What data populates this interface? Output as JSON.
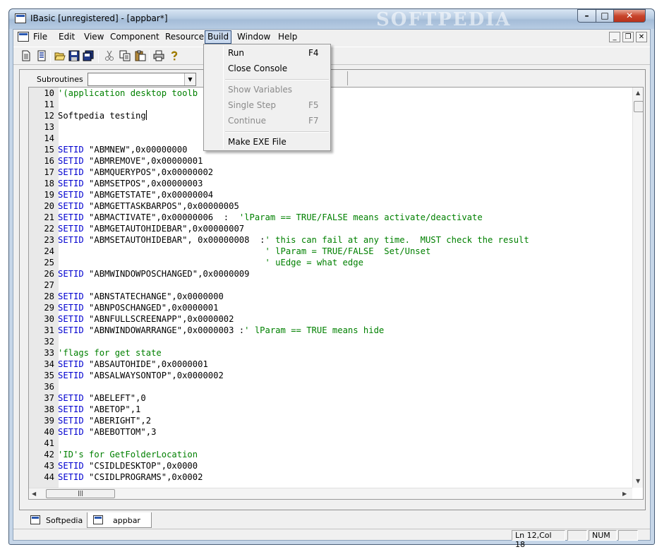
{
  "window": {
    "title": "IBasic [unregistered] - [appbar*]",
    "watermark": "SOFTPEDIA",
    "minimize": "–",
    "maximize": "□",
    "close": "✕"
  },
  "menubar": {
    "items": [
      {
        "label": "File"
      },
      {
        "label": "Edit"
      },
      {
        "label": "View"
      },
      {
        "label": "Component"
      },
      {
        "label": "Resource"
      },
      {
        "label": "Build"
      },
      {
        "label": "Window"
      },
      {
        "label": "Help"
      }
    ],
    "mdi_min": "_",
    "mdi_restore": "❐",
    "mdi_close": "✕"
  },
  "toolbar": {
    "icons": [
      "new-icon",
      "properties-icon",
      "open-icon",
      "save-icon",
      "save-all-icon",
      "cut-icon",
      "copy-icon",
      "paste-icon",
      "print-icon",
      "help-icon"
    ]
  },
  "subroutines": {
    "label": "Subroutines",
    "selected": ""
  },
  "build_menu": {
    "items": [
      {
        "label": "Run",
        "shortcut": "F4",
        "enabled": true
      },
      {
        "label": "Close Console",
        "shortcut": "",
        "enabled": true
      },
      {
        "label": "Show Variables",
        "shortcut": "",
        "enabled": false
      },
      {
        "label": "Single Step",
        "shortcut": "F5",
        "enabled": false
      },
      {
        "label": "Continue",
        "shortcut": "F7",
        "enabled": false
      },
      {
        "label": "Make EXE File",
        "shortcut": "",
        "enabled": true
      }
    ]
  },
  "editor": {
    "lines": [
      {
        "n": "10",
        "parts": [
          [
            "cm",
            "'(application desktop toolb"
          ]
        ]
      },
      {
        "n": "11",
        "parts": []
      },
      {
        "n": "12",
        "parts": [
          [
            "tx",
            "Softpedia testing"
          ]
        ],
        "caret": true
      },
      {
        "n": "13",
        "parts": []
      },
      {
        "n": "14",
        "parts": []
      },
      {
        "n": "15",
        "parts": [
          [
            "kw",
            "SETID"
          ],
          [
            "tx",
            " \"ABMNEW\",0x00000000"
          ]
        ]
      },
      {
        "n": "16",
        "parts": [
          [
            "kw",
            "SETID"
          ],
          [
            "tx",
            " \"ABMREMOVE\",0x00000001"
          ]
        ]
      },
      {
        "n": "17",
        "parts": [
          [
            "kw",
            "SETID"
          ],
          [
            "tx",
            " \"ABMQUERYPOS\",0x00000002"
          ]
        ]
      },
      {
        "n": "18",
        "parts": [
          [
            "kw",
            "SETID"
          ],
          [
            "tx",
            " \"ABMSETPOS\",0x00000003"
          ]
        ]
      },
      {
        "n": "19",
        "parts": [
          [
            "kw",
            "SETID"
          ],
          [
            "tx",
            " \"ABMGETSTATE\",0x00000004"
          ]
        ]
      },
      {
        "n": "20",
        "parts": [
          [
            "kw",
            "SETID"
          ],
          [
            "tx",
            " \"ABMGETTASKBARPOS\",0x00000005"
          ]
        ]
      },
      {
        "n": "21",
        "parts": [
          [
            "kw",
            "SETID"
          ],
          [
            "tx",
            " \"ABMACTIVATE\",0x00000006  :  "
          ],
          [
            "cm",
            "'lParam == TRUE/FALSE means activate/deactivate"
          ]
        ]
      },
      {
        "n": "22",
        "parts": [
          [
            "kw",
            "SETID"
          ],
          [
            "tx",
            " \"ABMGETAUTOHIDEBAR\",0x00000007"
          ]
        ]
      },
      {
        "n": "23",
        "parts": [
          [
            "kw",
            "SETID"
          ],
          [
            "tx",
            " \"ABMSETAUTOHIDEBAR\", 0x00000008  :"
          ],
          [
            "cm",
            "' this can fail at any time.  MUST check the result"
          ]
        ]
      },
      {
        "n": "24",
        "parts": [
          [
            "cm",
            "                                        ' lParam = TRUE/FALSE  Set/Unset"
          ]
        ]
      },
      {
        "n": "25",
        "parts": [
          [
            "cm",
            "                                        ' uEdge = what edge"
          ]
        ]
      },
      {
        "n": "26",
        "parts": [
          [
            "kw",
            "SETID"
          ],
          [
            "tx",
            " \"ABMWINDOWPOSCHANGED\",0x0000009"
          ]
        ]
      },
      {
        "n": "27",
        "parts": []
      },
      {
        "n": "28",
        "parts": [
          [
            "kw",
            "SETID"
          ],
          [
            "tx",
            " \"ABNSTATECHANGE\",0x0000000"
          ]
        ]
      },
      {
        "n": "29",
        "parts": [
          [
            "kw",
            "SETID"
          ],
          [
            "tx",
            " \"ABNPOSCHANGED\",0x0000001"
          ]
        ]
      },
      {
        "n": "30",
        "parts": [
          [
            "kw",
            "SETID"
          ],
          [
            "tx",
            " \"ABNFULLSCREENAPP\",0x0000002"
          ]
        ]
      },
      {
        "n": "31",
        "parts": [
          [
            "kw",
            "SETID"
          ],
          [
            "tx",
            " \"ABNWINDOWARRANGE\",0x0000003 :"
          ],
          [
            "cm",
            "' lParam == TRUE means hide"
          ]
        ]
      },
      {
        "n": "32",
        "parts": []
      },
      {
        "n": "33",
        "parts": [
          [
            "cm",
            "'flags for get state"
          ]
        ]
      },
      {
        "n": "34",
        "parts": [
          [
            "kw",
            "SETID"
          ],
          [
            "tx",
            " \"ABSAUTOHIDE\",0x0000001"
          ]
        ]
      },
      {
        "n": "35",
        "parts": [
          [
            "kw",
            "SETID"
          ],
          [
            "tx",
            " \"ABSALWAYSONTOP\",0x0000002"
          ]
        ]
      },
      {
        "n": "36",
        "parts": []
      },
      {
        "n": "37",
        "parts": [
          [
            "kw",
            "SETID"
          ],
          [
            "tx",
            " \"ABELEFT\",0"
          ]
        ]
      },
      {
        "n": "38",
        "parts": [
          [
            "kw",
            "SETID"
          ],
          [
            "tx",
            " \"ABETOP\",1"
          ]
        ]
      },
      {
        "n": "39",
        "parts": [
          [
            "kw",
            "SETID"
          ],
          [
            "tx",
            " \"ABERIGHT\",2"
          ]
        ]
      },
      {
        "n": "40",
        "parts": [
          [
            "kw",
            "SETID"
          ],
          [
            "tx",
            " \"ABEBOTTOM\",3"
          ]
        ]
      },
      {
        "n": "41",
        "parts": []
      },
      {
        "n": "42",
        "parts": [
          [
            "cm",
            "'ID's for GetFolderLocation"
          ]
        ]
      },
      {
        "n": "43",
        "parts": [
          [
            "kw",
            "SETID"
          ],
          [
            "tx",
            " \"CSIDLDESKTOP\",0x0000"
          ]
        ]
      },
      {
        "n": "44",
        "parts": [
          [
            "kw",
            "SETID"
          ],
          [
            "tx",
            " \"CSIDLPROGRAMS\",0x0002"
          ]
        ]
      }
    ]
  },
  "tabs": [
    {
      "label": "Softpedia",
      "active": false
    },
    {
      "label": "appbar",
      "active": true
    }
  ],
  "status": {
    "position": "Ln 12,Col 18",
    "num": "NUM"
  },
  "colors": {
    "keyword": "#0000d0",
    "comment": "#008000"
  }
}
